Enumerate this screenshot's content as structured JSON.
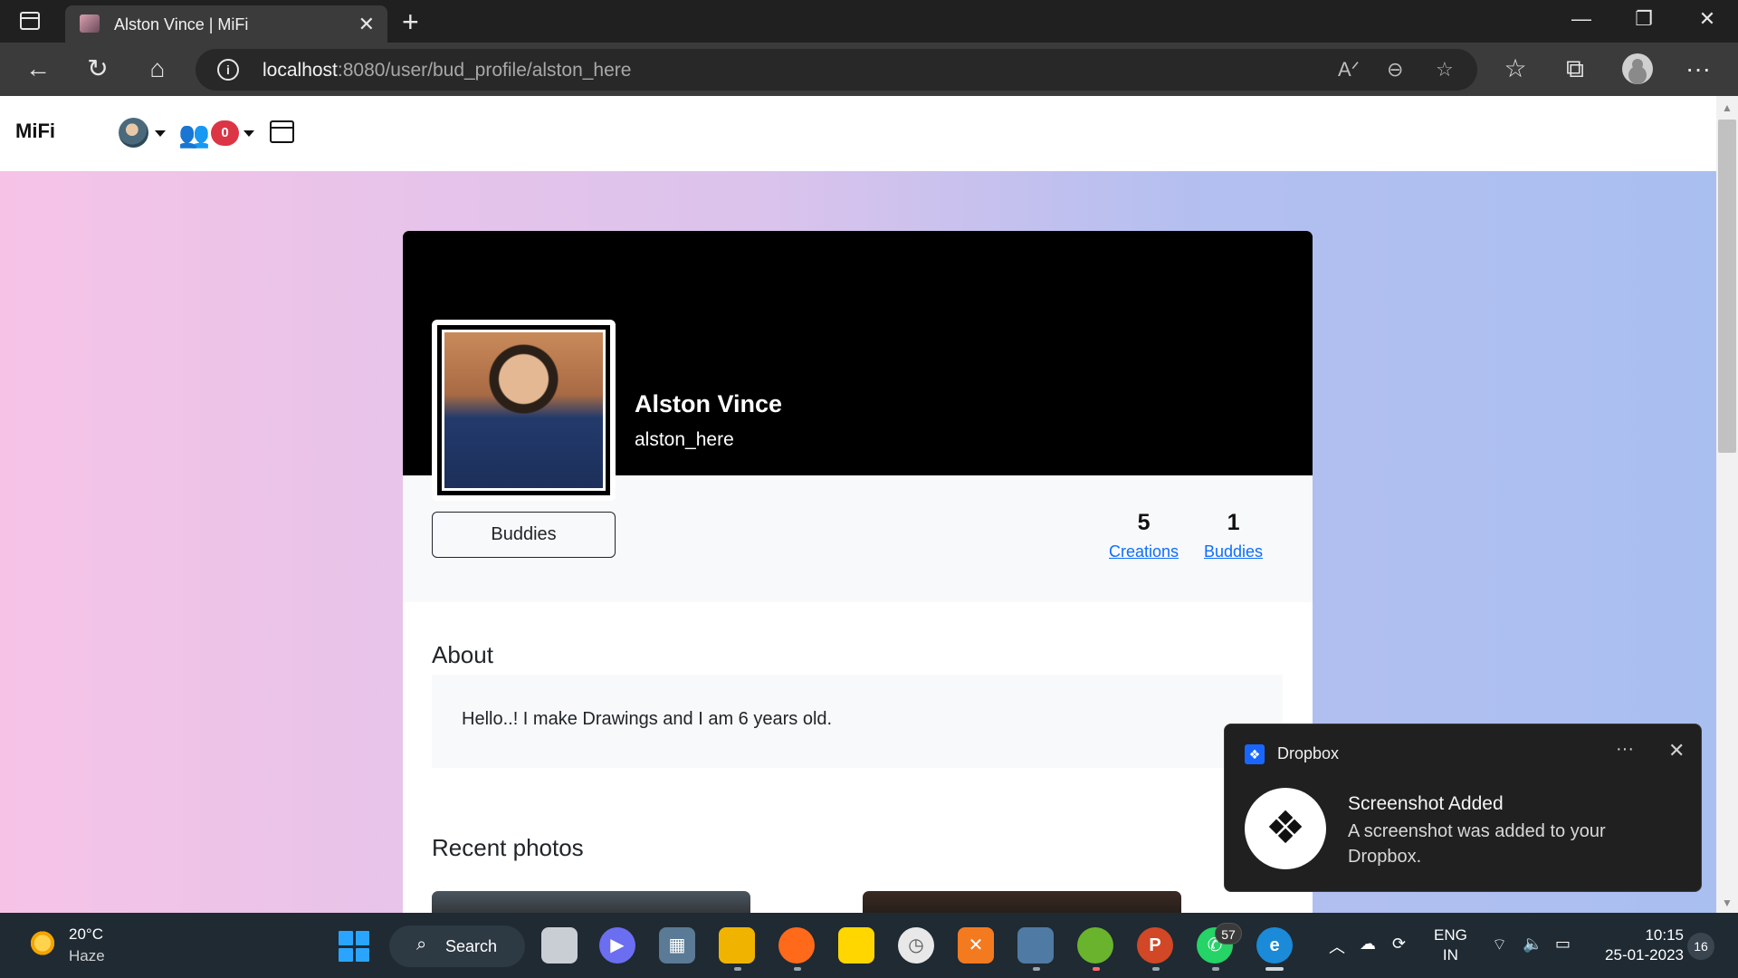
{
  "browser": {
    "tab_title": "Alston Vince | MiFi",
    "url_host": "localhost",
    "url_rest": ":8080/user/bud_profile/alston_here",
    "new_tab_glyph": "+",
    "close_glyph": "✕",
    "window_controls": [
      "—",
      "❐",
      "✕"
    ]
  },
  "site": {
    "brand": "MiFi",
    "notification_count": "0"
  },
  "profile": {
    "name": "Alston Vince",
    "handle": "alston_here",
    "buddies_button": "Buddies",
    "stats": [
      {
        "value": "5",
        "label": "Creations"
      },
      {
        "value": "1",
        "label": "Buddies"
      }
    ],
    "about_heading": "About",
    "about_text": "Hello..! I make Drawings and I am 6 years old.",
    "recent_heading": "Recent photos"
  },
  "toast": {
    "app": "Dropbox",
    "title": "Screenshot Added",
    "body": "A screenshot was added to your Dropbox.",
    "more_glyph": "···",
    "close_glyph": "✕"
  },
  "taskbar": {
    "weather_temp": "20°C",
    "weather_desc": "Haze",
    "search_label": "Search",
    "whatsapp_badge": "57",
    "lang_line1": "ENG",
    "lang_line2": "IN",
    "time": "10:15",
    "date": "25-01-2023",
    "notification_count": "16"
  },
  "colors": {
    "accent_link": "#0d6efd",
    "badge_red": "#dc3545",
    "dropbox_blue": "#1966ff"
  }
}
